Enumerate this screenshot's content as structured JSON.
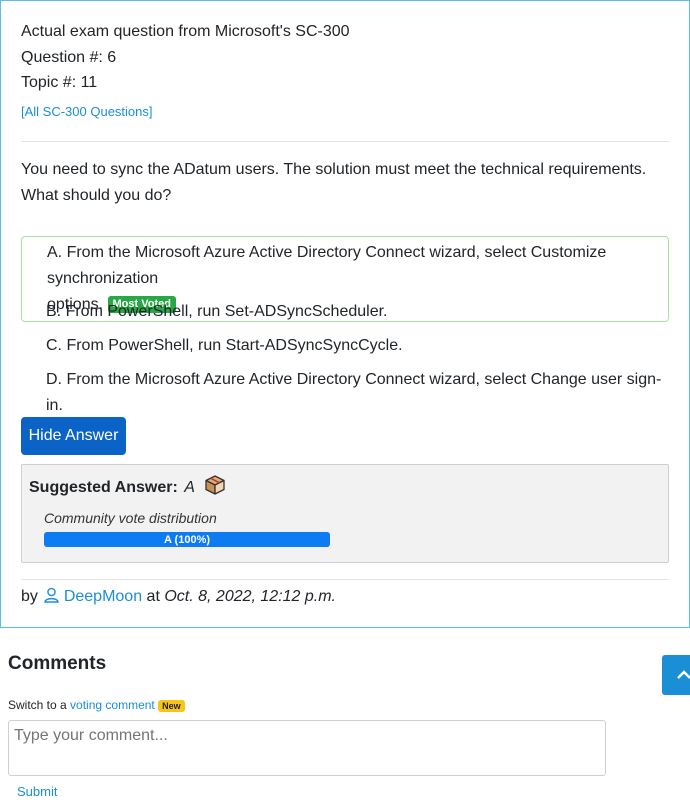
{
  "header": {
    "exam_line": "Actual exam question from Microsoft's SC-300",
    "question_number": "Question #: 6",
    "topic_number": "Topic #: 11",
    "all_questions_link": "[All SC-300 Questions]"
  },
  "question": {
    "line1": "You need to sync the ADatum users. The solution must meet the technical requirements.",
    "line2": "What should you do?"
  },
  "choices": [
    {
      "letter": "A.",
      "text_line1": "From the Microsoft Azure Active Directory Connect wizard, select Customize synchronization",
      "text_line2": "options.",
      "badge": "Most Voted"
    },
    {
      "letter": "B.",
      "text": "From PowerShell, run Set-ADSyncScheduler."
    },
    {
      "letter": "C.",
      "text": "From PowerShell, run Start-ADSyncSyncCycle."
    },
    {
      "letter": "D.",
      "text": "From the Microsoft Azure Active Directory Connect wizard, select Change user sign-in."
    }
  ],
  "hide_answer_label": "Hide Answer",
  "answer": {
    "suggested_label": "Suggested Answer:",
    "suggested_value": "A",
    "vote_distribution_label": "Community vote distribution",
    "vote_bar_label": "A (100%)",
    "vote_fraction": 1.0
  },
  "meta": {
    "by": "by",
    "author": "DeepMoon",
    "at": "at",
    "date": "Oct. 8, 2022, 12:12 p.m."
  },
  "comments": {
    "heading": "Comments",
    "switch_prefix": "Switch to a",
    "switch_link": "voting comment",
    "new_badge": "New",
    "placeholder": "Type your comment...",
    "submit": "Submit"
  },
  "colors": {
    "accent": "#1a8fd6",
    "primary_button": "#0b63c7",
    "most_voted": "#28a745",
    "correct_border": "#a6e3a1",
    "vote_bar": "#0d7bf2"
  },
  "icons": {
    "user": "user-icon",
    "reveal": "box-icon",
    "scroll_top": "chevron-up-icon"
  }
}
